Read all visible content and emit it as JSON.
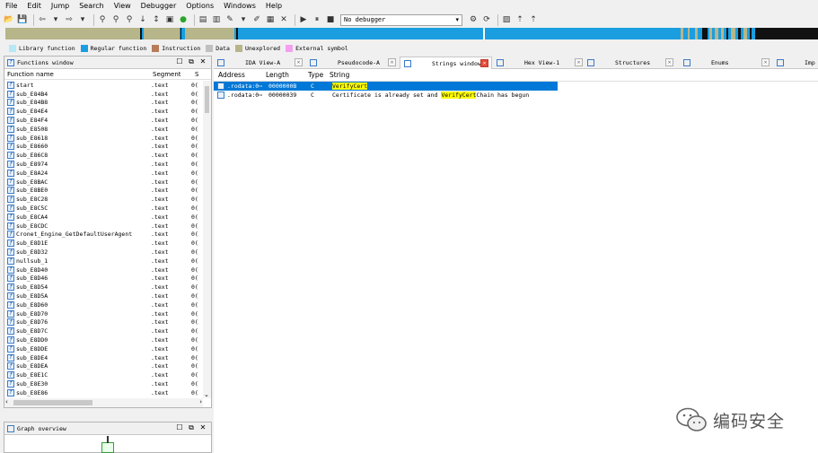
{
  "menu": [
    "File",
    "Edit",
    "Jump",
    "Search",
    "View",
    "Debugger",
    "Options",
    "Windows",
    "Help"
  ],
  "toolbar": {
    "debugger_value": "No debugger"
  },
  "legend": [
    {
      "label": "Library function",
      "color": "#b7e8f5"
    },
    {
      "label": "Regular function",
      "color": "#1a9ee0"
    },
    {
      "label": "Instruction",
      "color": "#b87c5a"
    },
    {
      "label": "Data",
      "color": "#c0c0c0"
    },
    {
      "label": "Unexplored",
      "color": "#b7b58a"
    },
    {
      "label": "External symbol",
      "color": "#f4a0f0"
    }
  ],
  "functions_window": {
    "title": "Functions window",
    "columns": {
      "name": "Function name",
      "segment": "Segment",
      "s": "S"
    },
    "rows": [
      {
        "name": "start",
        "segment": ".text",
        "s": "0("
      },
      {
        "name": "sub_E84B4",
        "segment": ".text",
        "s": "0("
      },
      {
        "name": "sub_E84B8",
        "segment": ".text",
        "s": "0("
      },
      {
        "name": "sub_E84E4",
        "segment": ".text",
        "s": "0("
      },
      {
        "name": "sub_E84F4",
        "segment": ".text",
        "s": "0("
      },
      {
        "name": "sub_E8508",
        "segment": ".text",
        "s": "0("
      },
      {
        "name": "sub_E8618",
        "segment": ".text",
        "s": "0("
      },
      {
        "name": "sub_E8660",
        "segment": ".text",
        "s": "0("
      },
      {
        "name": "sub_E86C8",
        "segment": ".text",
        "s": "0("
      },
      {
        "name": "sub_E8974",
        "segment": ".text",
        "s": "0("
      },
      {
        "name": "sub_E8A24",
        "segment": ".text",
        "s": "0("
      },
      {
        "name": "sub_E8BAC",
        "segment": ".text",
        "s": "0("
      },
      {
        "name": "sub_E8BE0",
        "segment": ".text",
        "s": "0("
      },
      {
        "name": "sub_E8C28",
        "segment": ".text",
        "s": "0("
      },
      {
        "name": "sub_E8C5C",
        "segment": ".text",
        "s": "0("
      },
      {
        "name": "sub_E8CA4",
        "segment": ".text",
        "s": "0("
      },
      {
        "name": "sub_E8CDC",
        "segment": ".text",
        "s": "0("
      },
      {
        "name": "Cronet_Engine_GetDefaultUserAgent",
        "segment": ".text",
        "s": "0("
      },
      {
        "name": "sub_E8D1E",
        "segment": ".text",
        "s": "0("
      },
      {
        "name": "sub_E8D32",
        "segment": ".text",
        "s": "0("
      },
      {
        "name": "nullsub_1",
        "segment": ".text",
        "s": "0("
      },
      {
        "name": "sub_E8D40",
        "segment": ".text",
        "s": "0("
      },
      {
        "name": "sub_E8D46",
        "segment": ".text",
        "s": "0("
      },
      {
        "name": "sub_E8D54",
        "segment": ".text",
        "s": "0("
      },
      {
        "name": "sub_E8D5A",
        "segment": ".text",
        "s": "0("
      },
      {
        "name": "sub_E8D60",
        "segment": ".text",
        "s": "0("
      },
      {
        "name": "sub_E8D70",
        "segment": ".text",
        "s": "0("
      },
      {
        "name": "sub_E8D76",
        "segment": ".text",
        "s": "0("
      },
      {
        "name": "sub_E8D7C",
        "segment": ".text",
        "s": "0("
      },
      {
        "name": "sub_E8DD0",
        "segment": ".text",
        "s": "0("
      },
      {
        "name": "sub_E8DDE",
        "segment": ".text",
        "s": "0("
      },
      {
        "name": "sub_E8DE4",
        "segment": ".text",
        "s": "0("
      },
      {
        "name": "sub_E8DEA",
        "segment": ".text",
        "s": "0("
      },
      {
        "name": "sub_E8E1C",
        "segment": ".text",
        "s": "0("
      },
      {
        "name": "sub_E8E30",
        "segment": ".text",
        "s": "0("
      },
      {
        "name": "sub_E8E86",
        "segment": ".text",
        "s": "0("
      },
      {
        "name": "sub_E8E90",
        "segment": ".text",
        "s": "0("
      }
    ]
  },
  "graph_overview": {
    "title": "Graph overview"
  },
  "tabs": [
    {
      "label": "IDA View-A",
      "icon": "ida-view-icon"
    },
    {
      "label": "Pseudocode-A",
      "icon": "pseudocode-icon"
    },
    {
      "label": "Strings window",
      "icon": "strings-icon",
      "active": true
    },
    {
      "label": "Hex View-1",
      "icon": "hex-view-icon"
    },
    {
      "label": "Structures",
      "icon": "structures-icon"
    },
    {
      "label": "Enums",
      "icon": "enums-icon"
    },
    {
      "label": "Imp",
      "icon": "imports-icon"
    }
  ],
  "strings_window": {
    "columns": {
      "address": "Address",
      "length": "Length",
      "type": "Type",
      "string": "String"
    },
    "rows": [
      {
        "address": ".rodata:0⋯",
        "length": "0000000B",
        "type": "C",
        "string_pre": "",
        "string_hl": "VerifyCert",
        "string_post": "",
        "selected": true
      },
      {
        "address": ".rodata:0⋯",
        "length": "00000039",
        "type": "C",
        "string_pre": "Certificate is already set and ",
        "string_hl": "VerifyCert",
        "string_post": "Chain has begun",
        "selected": false
      }
    ]
  },
  "watermark": {
    "text": "编码安全"
  }
}
